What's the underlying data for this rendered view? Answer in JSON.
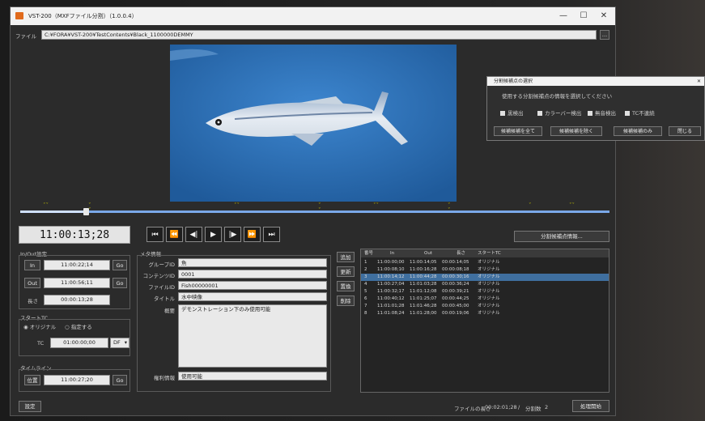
{
  "window": {
    "title": "VST-200（MXFファイル分割）（1.0.0.4）",
    "minimize": "—",
    "maximize": "☐",
    "close": "✕"
  },
  "file": {
    "label": "ファイル",
    "path": "C:¥FORA¥VST-200¥TestContents¥Black_1100000DEMMY",
    "browse": "…"
  },
  "player": {
    "timecode": "11:00:13;28",
    "split_info_button": "分割候補点情報..."
  },
  "inout": {
    "title": "In/Out設定",
    "in_label": "In",
    "in_value": "11:00:22;14",
    "in_go": "Go",
    "out_label": "Out",
    "out_value": "11:00:56;11",
    "out_go": "Go",
    "length_label": "長さ",
    "length_value": "00:00:13;28"
  },
  "start_tc": {
    "title": "スタートTC",
    "radio_original": "オリジナル",
    "radio_specified": "指定する",
    "tc_label": "TC",
    "tc_value": "01:00:00;00",
    "mode": "DF"
  },
  "timeline": {
    "title": "タイムライン",
    "position_label": "位置",
    "position_value": "11:00:27;20",
    "go": "Go"
  },
  "meta": {
    "title": "メタ情報",
    "group_label": "グループID",
    "group_value": "魚",
    "content_label": "コンテンツID",
    "content_value": "0001",
    "file_label": "ファイルID",
    "file_value": "Fish00000001",
    "title_label": "タイトル",
    "title_value": "水中映像",
    "summary_label": "概要",
    "summary_value": "デモンストレーション下のみ使用可能",
    "rights_label": "権利情報",
    "rights_value": "使用可能"
  },
  "list_buttons": {
    "add": "追加",
    "update": "更新",
    "replace": "置換",
    "delete": "削除"
  },
  "table": {
    "headers": [
      "番号",
      "In",
      "Out",
      "長さ",
      "スタートTC"
    ],
    "rows": [
      [
        "1",
        "11:00:00;00",
        "11:00:14;05",
        "00:00:14;05",
        "オリジナル"
      ],
      [
        "2",
        "11:00:08;10",
        "11:00:16;28",
        "00:00:08;18",
        "オリジナル"
      ],
      [
        "3",
        "11:00:14;12",
        "11:00:44;28",
        "00:00:30;16",
        "オリジナル"
      ],
      [
        "4",
        "11:00:27;04",
        "11:01:03;28",
        "00:00:36;24",
        "オリジナル"
      ],
      [
        "5",
        "11:00:32;17",
        "11:01:12;08",
        "00:00:39;21",
        "オリジナル"
      ],
      [
        "6",
        "11:00:40;12",
        "11:01:25;07",
        "00:00:44;25",
        "オリジナル"
      ],
      [
        "7",
        "11:01:01;28",
        "11:01:46;28",
        "00:00:45;00",
        "オリジナル"
      ],
      [
        "8",
        "11:01:08;24",
        "11:01:28;00",
        "00:00:19;06",
        "オリジナル"
      ]
    ],
    "selected_row": 3
  },
  "status": {
    "settings_button": "設定",
    "file_length_label": "ファイルの長さ",
    "file_length_value": "00:02:01;28",
    "separator": "/",
    "split_count_label": "分割数",
    "split_count_value": "2",
    "start_button": "処理開始"
  },
  "dialog": {
    "title": "分割候補点の選択",
    "close": "✕",
    "prompt": "使用する分割候補点の情報を選択してください",
    "options": [
      "黒検出",
      "カラーバー検出",
      "無音検出",
      "TC不連続"
    ],
    "buttons": [
      "候補候補を全て",
      "候補候補を除く",
      "候補候補のみ",
      "閉じる"
    ]
  },
  "colors": {
    "selected_row": "#3f6f9f",
    "timeline_fill": "#9fc4ff",
    "marker": "#c8c800"
  }
}
